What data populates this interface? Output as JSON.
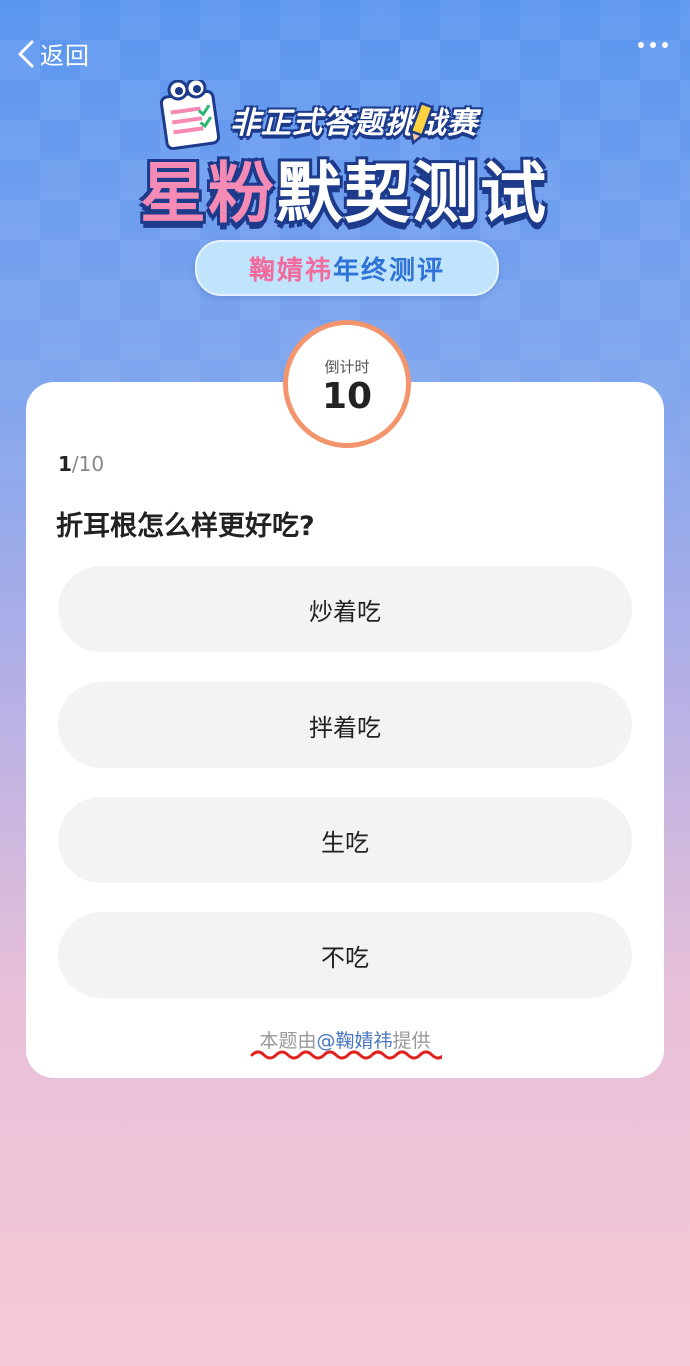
{
  "nav": {
    "back_label": "返回"
  },
  "banner": {
    "subtitle": "非正式答题挑战赛",
    "title_part1": "星粉",
    "title_part2": "默契测试"
  },
  "pill": {
    "name": "鞠婧祎",
    "suffix": "年终测评"
  },
  "timer": {
    "label": "倒计时",
    "value": "10"
  },
  "quiz": {
    "progress_current": "1",
    "progress_total": "/10",
    "question": "折耳根怎么样更好吃?",
    "options": [
      "炒着吃",
      "拌着吃",
      "生吃",
      "不吃"
    ]
  },
  "credit": {
    "prefix": "本题由",
    "user": "@鞠婧祎",
    "suffix": "提供"
  },
  "colors": {
    "accent_pink": "#f58bb4",
    "accent_blue": "#2f72d8",
    "timer_ring": "#f3946c",
    "squiggle_red": "#e0211e"
  }
}
